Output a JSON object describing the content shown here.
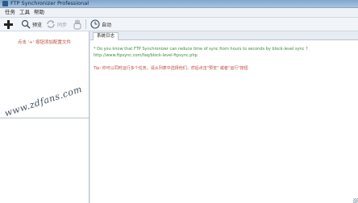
{
  "window": {
    "title": "FTP Synchronizer Professional"
  },
  "menu": {
    "items": [
      "任务",
      "工具",
      "帮助"
    ]
  },
  "toolbar": {
    "add_icon": "plus-icon",
    "preview_label": "预览",
    "sync_label": "同步",
    "stop_icon": "hand-icon",
    "auto_label": "自动"
  },
  "left_panel": {
    "hint": "点击 '+' 按钮添加配置文件",
    "watermark": "www.zdfans.com"
  },
  "log": {
    "tab": "系统日志",
    "tip1": "* Do you know that FTP Synchronizer can reduce time of sync from hours to seconds by block-level sync ?",
    "tip1_url": "http://www.ftpsync.com/faq/block-level-ftpsync.php",
    "tip2": "Tip: 你可以同时运行多个任务。请从列表中选择他们，然后点击\"预览\" 或者\"运行\"按钮"
  },
  "colors": {
    "green_text": "#3c8a3a",
    "red_text": "#b84a3c",
    "titlebar": "#7fa6cc"
  }
}
